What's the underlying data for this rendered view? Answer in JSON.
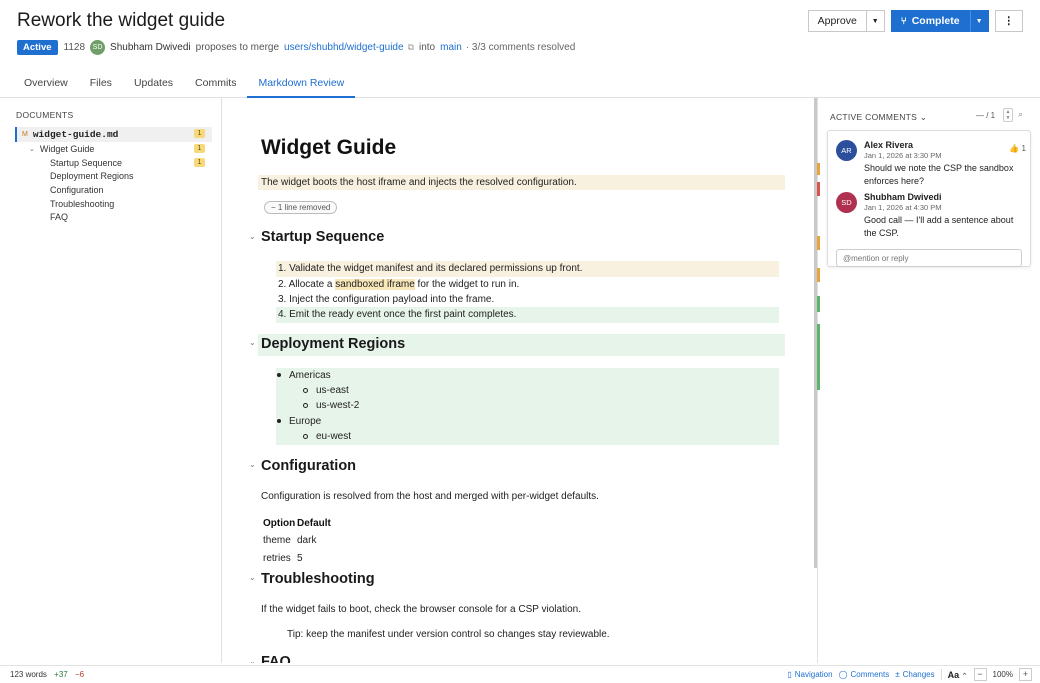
{
  "header": {
    "title": "Rework the widget guide",
    "status": "Active",
    "pr_id": "1128",
    "author_initials": "SD",
    "author": "Shubham Dwivedi",
    "proposes_text": "proposes to merge",
    "source_branch": "users/shubhd/widget-guide",
    "into_text": "into",
    "target_branch": "main",
    "comments_resolved": "· 3/3 comments resolved",
    "approve_label": "Approve",
    "complete_label": "Complete",
    "more_label": "⋮"
  },
  "tabs": [
    {
      "label": "Overview"
    },
    {
      "label": "Files"
    },
    {
      "label": "Updates"
    },
    {
      "label": "Commits"
    },
    {
      "label": "Markdown Review"
    }
  ],
  "sidebar": {
    "heading": "DOCUMENTS",
    "file": {
      "marker": "M",
      "name": "widget-guide.md",
      "count": "1"
    },
    "items": [
      {
        "label": "Widget Guide",
        "count": "1"
      },
      {
        "label": "Startup Sequence",
        "count": "1"
      },
      {
        "label": "Deployment Regions"
      },
      {
        "label": "Configuration"
      },
      {
        "label": "Troubleshooting"
      },
      {
        "label": "FAQ"
      }
    ]
  },
  "doc": {
    "h1": "Widget Guide",
    "intro": "The widget boots the host iframe and injects the resolved configuration.",
    "removed_pill": "− 1 line removed",
    "startup": {
      "heading": "Startup Sequence",
      "steps": [
        {
          "num": "1.",
          "text": "Validate the widget manifest and its declared permissions up front."
        },
        {
          "num": "2.",
          "pre": "Allocate a ",
          "mark": "sandboxed iframe",
          "post": " for the widget to run in."
        },
        {
          "num": "3.",
          "text": "Inject the configuration payload into the frame."
        },
        {
          "num": "4.",
          "text": "Emit the ready event once the first paint completes."
        }
      ]
    },
    "regions": {
      "heading": "Deployment Regions",
      "americas": "Americas",
      "us_east": "us-east",
      "us_west": "us-west-2",
      "europe": "Europe",
      "eu_west": "eu-west"
    },
    "config": {
      "heading": "Configuration",
      "para": "Configuration is resolved from the host and merged with per-widget defaults.",
      "col_option": "Option",
      "col_default": "Default",
      "rows": [
        {
          "option": "theme",
          "default": "dark"
        },
        {
          "option": "retries",
          "default": "5"
        }
      ]
    },
    "trouble": {
      "heading": "Troubleshooting",
      "para": "If the widget fails to boot, check the browser console for a CSP violation.",
      "tip": "Tip: keep the manifest under version control so changes stay reviewable."
    },
    "faq_heading": "FAQ"
  },
  "comments": {
    "heading": "ACTIVE COMMENTS",
    "count": "— / 1",
    "thread": [
      {
        "initials": "AR",
        "author": "Alex Rivera",
        "time": "Jan 1, 2026 at 3:30 PM",
        "body": "Should we note the CSP the sandbox enforces here?",
        "reaction": "👍 1",
        "color": "#2b4f9c"
      },
      {
        "initials": "SD",
        "author": "Shubham Dwivedi",
        "time": "Jan 1, 2026 at 4:30 PM",
        "body": "Good call — I'll add a sentence about the CSP.",
        "color": "#b0314f"
      }
    ],
    "reply_placeholder": "@mention or reply"
  },
  "status": {
    "words": "123 words",
    "added": "+37",
    "removed": "−6",
    "navigation": "Navigation",
    "comments": "Comments",
    "changes": "Changes",
    "aa": "Aa",
    "zoom": "100%"
  },
  "colors": {
    "accent": "#1e6fd0",
    "added_bg": "#e7f4e9",
    "modified_bg": "#f9f1df",
    "gutter_orange": "#e8a43c",
    "gutter_red": "#d9534f",
    "gutter_green": "#5bb56a"
  }
}
